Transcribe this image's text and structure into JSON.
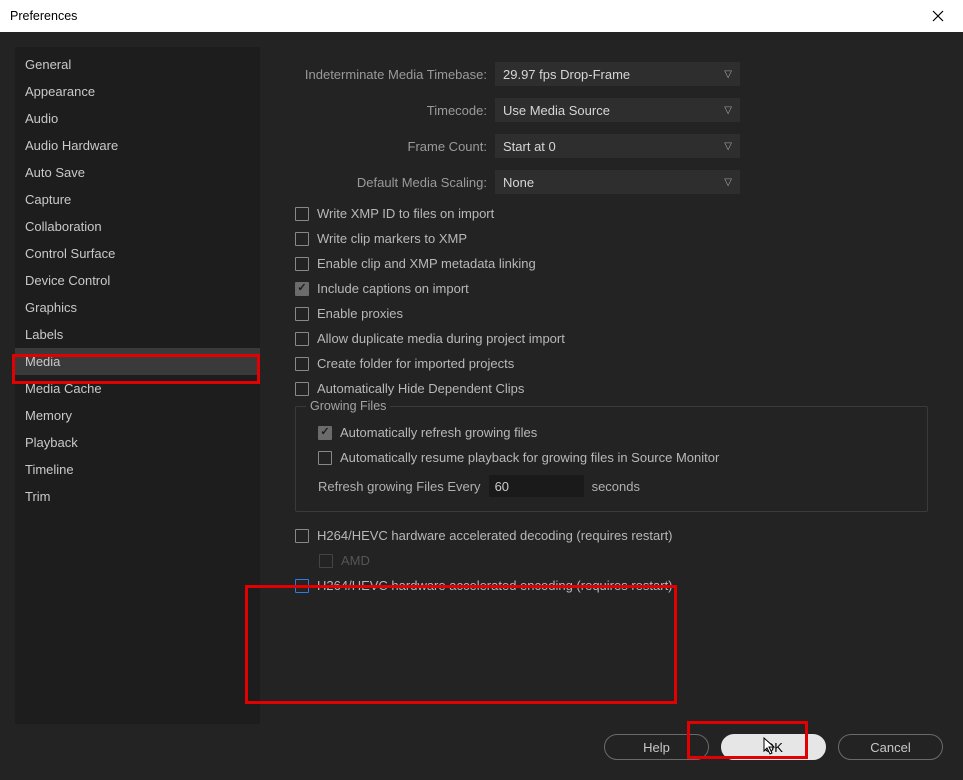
{
  "window": {
    "title": "Preferences"
  },
  "sidebar": {
    "items": [
      {
        "label": "General"
      },
      {
        "label": "Appearance"
      },
      {
        "label": "Audio"
      },
      {
        "label": "Audio Hardware"
      },
      {
        "label": "Auto Save"
      },
      {
        "label": "Capture"
      },
      {
        "label": "Collaboration"
      },
      {
        "label": "Control Surface"
      },
      {
        "label": "Device Control"
      },
      {
        "label": "Graphics"
      },
      {
        "label": "Labels"
      },
      {
        "label": "Media"
      },
      {
        "label": "Media Cache"
      },
      {
        "label": "Memory"
      },
      {
        "label": "Playback"
      },
      {
        "label": "Timeline"
      },
      {
        "label": "Trim"
      }
    ],
    "selected_index": 11
  },
  "dropdowns": {
    "timebase": {
      "label": "Indeterminate Media Timebase:",
      "value": "29.97 fps Drop-Frame"
    },
    "timecode": {
      "label": "Timecode:",
      "value": "Use Media Source"
    },
    "framecount": {
      "label": "Frame Count:",
      "value": "Start at 0"
    },
    "scaling": {
      "label": "Default Media Scaling:",
      "value": "None"
    }
  },
  "checks": {
    "xmp_id": {
      "label": "Write XMP ID to files on import",
      "checked": false
    },
    "clip_markers": {
      "label": "Write clip markers to XMP",
      "checked": false
    },
    "metadata_link": {
      "label": "Enable clip and XMP metadata linking",
      "checked": false
    },
    "captions": {
      "label": "Include captions on import",
      "checked": true
    },
    "proxies": {
      "label": "Enable proxies",
      "checked": false
    },
    "dup_media": {
      "label": "Allow duplicate media during project import",
      "checked": false
    },
    "create_folder": {
      "label": "Create folder for imported projects",
      "checked": false
    },
    "hide_dep": {
      "label": "Automatically Hide Dependent Clips",
      "checked": false
    },
    "hw_decode": {
      "label": "H264/HEVC hardware accelerated decoding (requires restart)",
      "checked": false
    },
    "amd": {
      "label": "AMD",
      "checked": false
    },
    "hw_encode": {
      "label": "H264/HEVC hardware accelerated encoding (requires restart)",
      "checked": false
    }
  },
  "growing": {
    "legend": "Growing Files",
    "auto_refresh": {
      "label": "Automatically refresh growing files",
      "checked": true
    },
    "auto_resume": {
      "label": "Automatically resume playback for growing files in Source Monitor",
      "checked": false
    },
    "refresh_label": "Refresh growing Files Every",
    "refresh_value": "60",
    "refresh_unit": "seconds"
  },
  "footer": {
    "help": "Help",
    "ok": "OK",
    "cancel": "Cancel"
  }
}
